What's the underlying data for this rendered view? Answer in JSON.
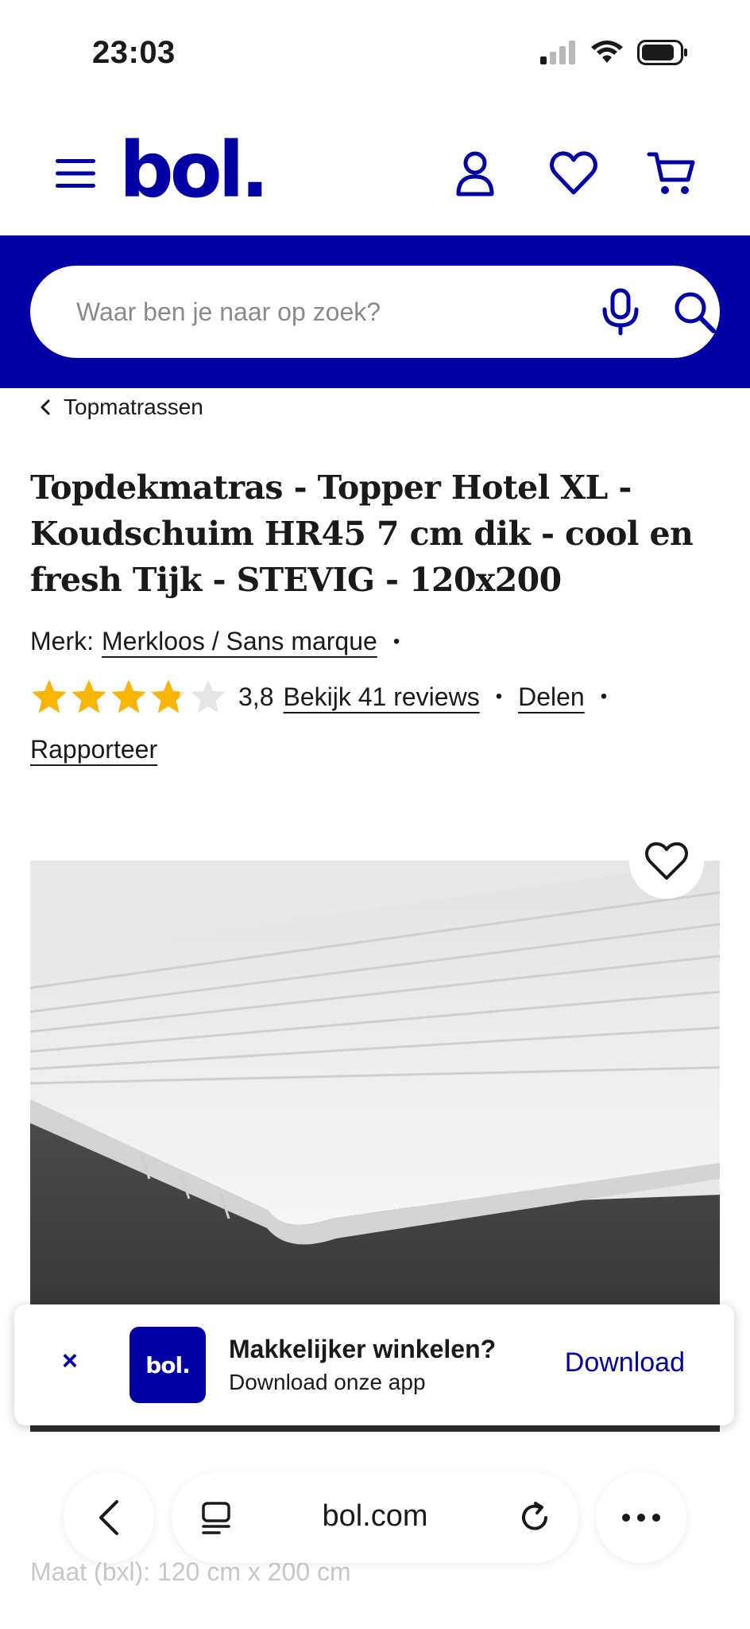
{
  "status": {
    "time": "23:03"
  },
  "header": {
    "logo": "bol."
  },
  "search": {
    "placeholder": "Waar ben je naar op zoek?"
  },
  "breadcrumb": {
    "label": "Topmatrassen"
  },
  "product": {
    "title": "Topdekmatras - Topper Hotel XL - Koudschuim HR45 7 cm dik - cool en fresh Tijk - STEVIG - 120x200",
    "brand_label": "Merk:",
    "brand": "Merkloos / Sans marque",
    "rating": 3.8,
    "rating_text": "3,8",
    "reviews_link": "Bekijk 41 reviews",
    "share_link": "Delen",
    "report_link": "Rapporteer",
    "spec": "Maat (bxl):  120 cm x 200 cm"
  },
  "banner": {
    "logo": "bol.",
    "close": "×",
    "title": "Makkelijker winkelen?",
    "subtitle": "Download onze app",
    "download": "Download"
  },
  "browser": {
    "url": "bol.com"
  },
  "colors": {
    "brand": "#0000a4",
    "star": "#f7b500",
    "star_empty": "#e6e6e6"
  }
}
